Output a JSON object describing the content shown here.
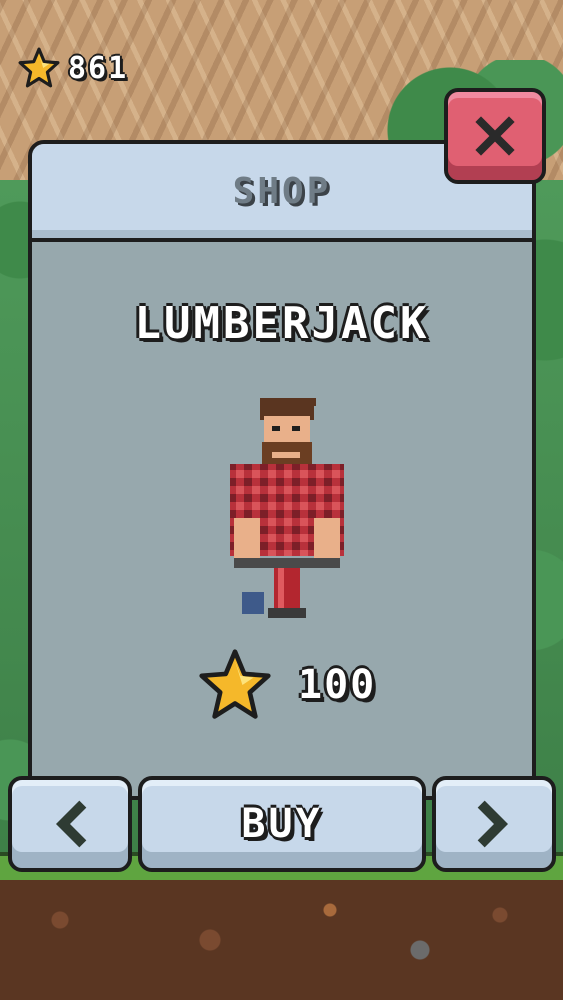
{
  "hud": {
    "star_count": "861",
    "star_icon": "star-icon"
  },
  "shop": {
    "title": "SHOP",
    "item_name": "LUMBERJACK",
    "price": "100",
    "buy_label": "BUY",
    "close_icon": "close-icon",
    "prev_icon": "chevron-left-icon",
    "next_icon": "chevron-right-icon"
  },
  "colors": {
    "panel_header": "#c7d8ea",
    "panel_body": "#97a8ad",
    "close_button": "#e06072",
    "star": "#f5b82a"
  }
}
